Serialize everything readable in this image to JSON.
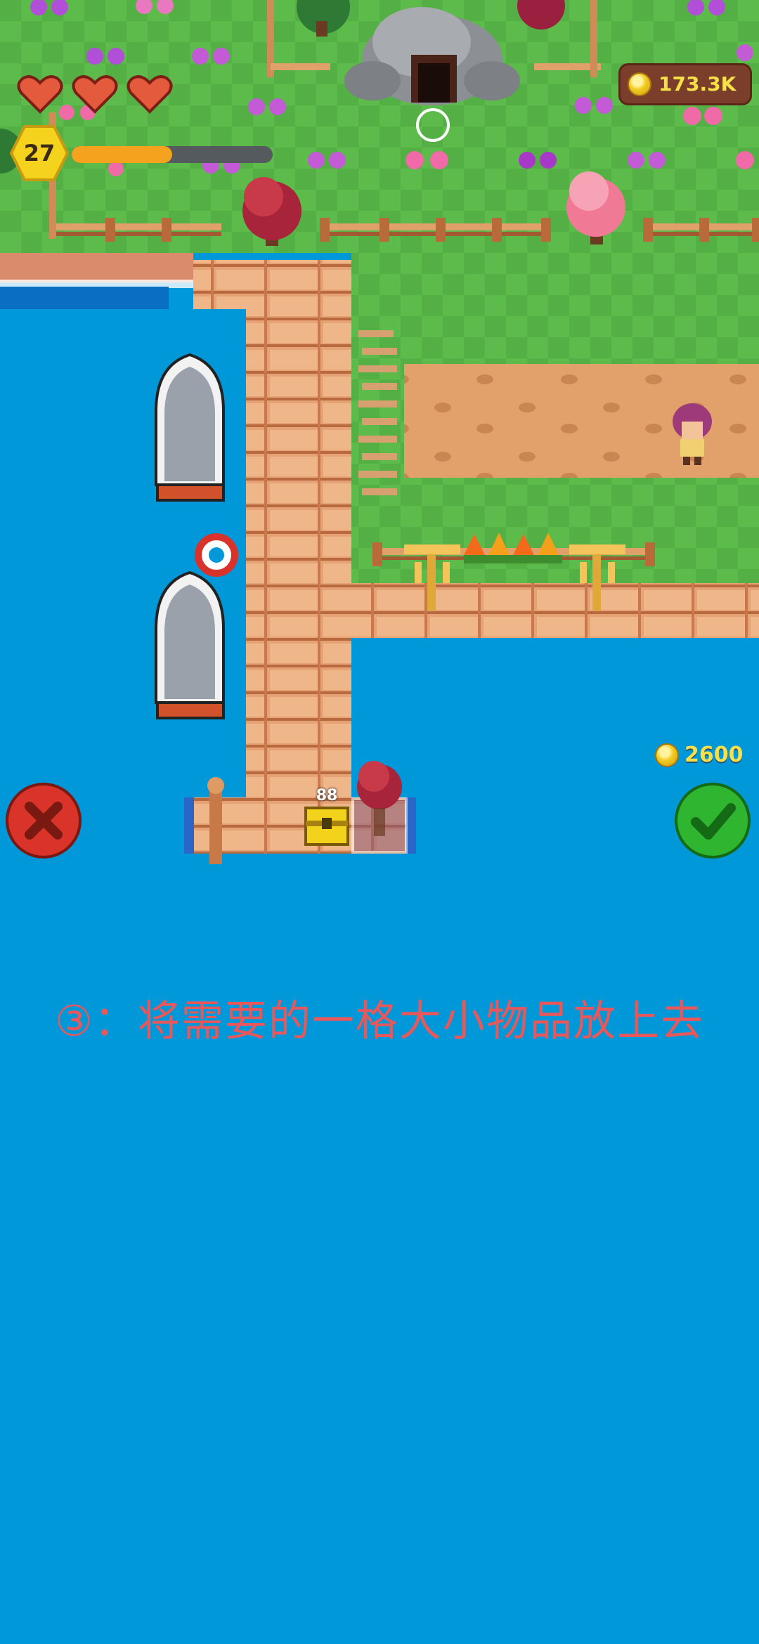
{
  "hud": {
    "level": "27",
    "hearts": 3,
    "xp_progress": 0.5,
    "coins": "173.3K"
  },
  "placement": {
    "cost": "2600",
    "item_label": "88",
    "cancel_icon": "x-icon",
    "confirm_icon": "checkmark-icon"
  },
  "instruction": {
    "text": "③：将需要的一格大小物品放上去"
  },
  "colors": {
    "water": "#0098d9",
    "grass": "#58b848",
    "path": "#e2a06a",
    "instruction": "#e8585a",
    "coin_text": "#f5e04a",
    "cancel": "#d9332a",
    "confirm": "#2fb52f"
  }
}
